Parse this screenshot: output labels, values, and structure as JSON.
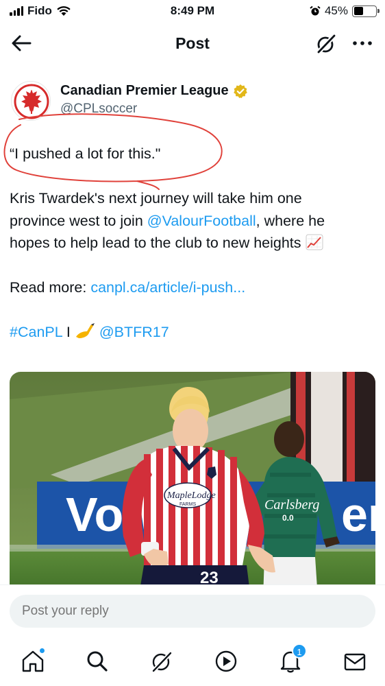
{
  "status_bar": {
    "carrier": "Fido",
    "time": "8:49 PM",
    "battery": "45%",
    "battery_level": 0.45
  },
  "header": {
    "title": "Post"
  },
  "author": {
    "name": "Canadian Premier League",
    "handle": "@CPLsoccer"
  },
  "tweet": {
    "quote": "“I pushed a lot for this.\"",
    "body_line1": "Kris Twardek's next journey will take him one",
    "body_line2_pre": "province west to join ",
    "mention_valour": "@ValourFootball",
    "body_line2_post": ", where he",
    "body_line3": "hopes to help lead to the club to new heights",
    "read_more_label": "Read more: ",
    "read_more_link": "canpl.ca/article/i-push...",
    "hashtag": "#CanPL",
    "separator": " I ",
    "photographer": "@BTFR17"
  },
  "media": {
    "ad_board_text": "Vo                                         en",
    "sponsor_text": "MapleLodge",
    "sponsor_sub": "FARMS",
    "opponent_sponsor": "Carlsberg",
    "opponent_sponsor_sub": "0.0",
    "shirt_number": "23"
  },
  "reply": {
    "placeholder": "Post your reply"
  },
  "tabbar": {
    "notifications_badge": "1"
  },
  "colors": {
    "accent": "#1d9bf0",
    "text": "#0f1419",
    "secondary": "#536471",
    "annotation": "#e0413a"
  }
}
